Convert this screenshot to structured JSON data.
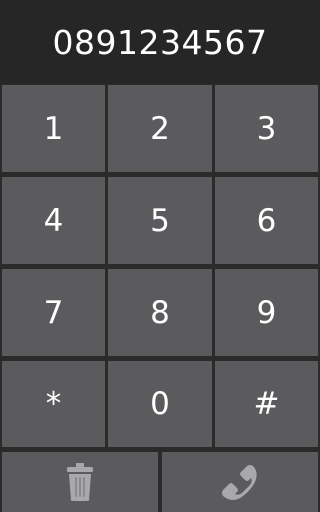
{
  "display": {
    "number": "0891234567"
  },
  "keypad": {
    "keys": [
      "1",
      "2",
      "3",
      "4",
      "5",
      "6",
      "7",
      "8",
      "9",
      "*",
      "0",
      "#"
    ]
  },
  "actions": {
    "delete_icon": "trash-icon",
    "call_icon": "phone-icon"
  },
  "colors": {
    "background": "#2b2b2b",
    "display_background": "#262626",
    "key_background": "#5b5b5e",
    "text": "#ffffff",
    "icon": "#a9a9ac"
  }
}
